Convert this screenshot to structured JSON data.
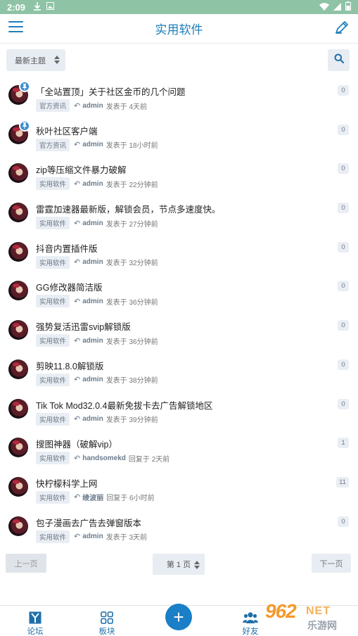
{
  "status_bar": {
    "time": "2:09",
    "icons": [
      "download-icon",
      "image-icon",
      "wifi-icon",
      "signal-icon",
      "battery-icon"
    ]
  },
  "app_bar": {
    "title": "实用软件",
    "left_icon": "menu-icon",
    "right_icon": "compose-icon",
    "accent": "#1e7fb8"
  },
  "filter": {
    "sort_label": "最新主题",
    "search_icon": "search-icon"
  },
  "threads": [
    {
      "title": "「全站置顶」关于社区金币的几个问题",
      "tag": "官方资讯",
      "author": "admin",
      "action": "发表于 4天前",
      "count": "0",
      "pinned": true
    },
    {
      "title": "秋叶社区客户端",
      "tag": "官方资讯",
      "author": "admin",
      "action": "发表于 18小时前",
      "count": "0",
      "pinned": true
    },
    {
      "title": "zip等压缩文件暴力破解",
      "tag": "实用软件",
      "author": "admin",
      "action": "发表于 22分钟前",
      "count": "0",
      "pinned": false
    },
    {
      "title": "雷霆加速器最新版，解锁会员，节点多速度快。",
      "tag": "实用软件",
      "author": "admin",
      "action": "发表于 27分钟前",
      "count": "0",
      "pinned": false
    },
    {
      "title": "抖音内置插件版",
      "tag": "实用软件",
      "author": "admin",
      "action": "发表于 32分钟前",
      "count": "0",
      "pinned": false
    },
    {
      "title": "GG修改器简洁版",
      "tag": "实用软件",
      "author": "admin",
      "action": "发表于 36分钟前",
      "count": "0",
      "pinned": false
    },
    {
      "title": "强势复活迅雷svip解锁版",
      "tag": "实用软件",
      "author": "admin",
      "action": "发表于 36分钟前",
      "count": "0",
      "pinned": false
    },
    {
      "title": "剪映11.8.0解锁版",
      "tag": "实用软件",
      "author": "admin",
      "action": "发表于 38分钟前",
      "count": "0",
      "pinned": false
    },
    {
      "title": "Tik Tok Mod32.0.4最新免拔卡去广告解锁地区",
      "tag": "实用软件",
      "author": "admin",
      "action": "发表于 39分钟前",
      "count": "0",
      "pinned": false
    },
    {
      "title": "搜图神器（破解vip）",
      "tag": "实用软件",
      "author": "handsomekd",
      "action": "回复于 2天前",
      "count": "1",
      "pinned": false
    },
    {
      "title": "快柠檬科学上网",
      "tag": "实用软件",
      "author": "绫波丽",
      "action": "回复于 6小时前",
      "count": "11",
      "pinned": false
    },
    {
      "title": "包子漫画去广告去弹窗版本",
      "tag": "实用软件",
      "author": "admin",
      "action": "发表于 3天前",
      "count": "0",
      "pinned": false
    }
  ],
  "pager": {
    "prev_label": "上一页",
    "page_label": "第 1 页",
    "next_label": "下一页"
  },
  "tabbar": {
    "tabs": [
      {
        "label": "论坛",
        "icon": "forum-icon"
      },
      {
        "label": "板块",
        "icon": "grid-icon"
      },
      {
        "label": "好友",
        "icon": "friends-icon"
      }
    ],
    "fab_symbol": "+"
  },
  "watermark": {
    "number": "962",
    "net": "NET",
    "sub": "乐游网"
  }
}
